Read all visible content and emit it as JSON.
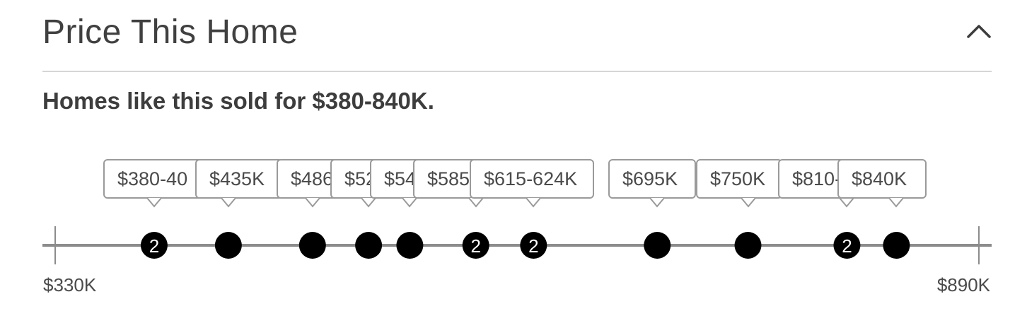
{
  "header": {
    "title": "Price This Home"
  },
  "summary": {
    "text": "Homes like this sold for $380-840K."
  },
  "chart_data": {
    "type": "scatter",
    "axis": {
      "min_label": "$330K",
      "max_label": "$890K",
      "min": 330,
      "max": 890
    },
    "points": [
      {
        "price": 390,
        "label": "$380-40",
        "count": "2"
      },
      {
        "price": 435,
        "label": "$435K",
        "count": ""
      },
      {
        "price": 486,
        "label": "$486",
        "count": ""
      },
      {
        "price": 520,
        "label": "$52",
        "count": ""
      },
      {
        "price": 545,
        "label": "$54",
        "count": ""
      },
      {
        "price": 585,
        "label": "$585",
        "count": "2"
      },
      {
        "price": 620,
        "label": "$615-624K",
        "count": "2"
      },
      {
        "price": 695,
        "label": "$695K",
        "count": ""
      },
      {
        "price": 750,
        "label": "$750K",
        "count": ""
      },
      {
        "price": 810,
        "label": "$810-",
        "count": "2"
      },
      {
        "price": 840,
        "label": "$840K",
        "count": ""
      }
    ]
  },
  "colors": {
    "marker": "#000000",
    "axis": "#8c8c8c",
    "bubble_border": "#9a9a9a",
    "divider": "#d6d6d6"
  },
  "icons": {
    "collapse": "chevron-up-icon"
  }
}
